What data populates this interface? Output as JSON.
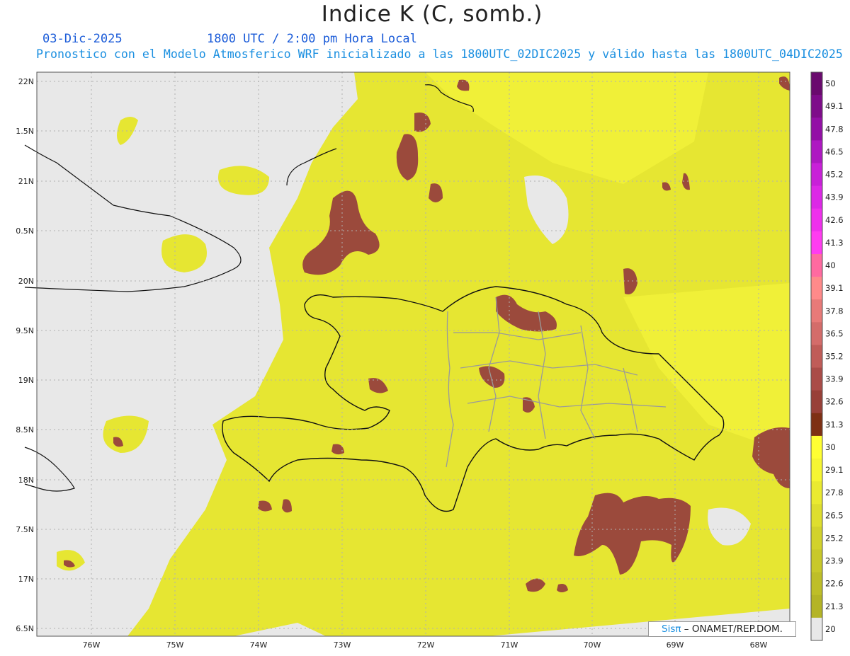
{
  "header": {
    "title": "Indice K (C, somb.)",
    "date": "03-Dic-2025",
    "time": "1800 UTC / 2:00 pm Hora Local",
    "subtitle": "Pronostico con el Modelo Atmosferico WRF inicializado a las 1800UTC_02DIC2025 y válido hasta las  1800UTC_04DIC2025"
  },
  "axes": {
    "lon_ticks": [
      "76W",
      "75W",
      "74W",
      "73W",
      "72W",
      "71W",
      "70W",
      "69W",
      "68W"
    ],
    "lat_ticks": [
      "22N",
      "1.5N",
      "21N",
      "0.5N",
      "20N",
      "9.5N",
      "19N",
      "8.5N",
      "18N",
      "7.5N",
      "17N",
      "6.5N"
    ]
  },
  "colorbar": {
    "labels": [
      "50",
      "49.1",
      "47.8",
      "46.5",
      "45.2",
      "43.9",
      "42.6",
      "41.3",
      "40",
      "39.1",
      "37.8",
      "36.5",
      "35.2",
      "33.9",
      "32.6",
      "31.3",
      "30",
      "29.1",
      "27.8",
      "26.5",
      "25.2",
      "23.9",
      "22.6",
      "21.3",
      "20"
    ],
    "colors": [
      "#6a0a6e",
      "#7e0c8a",
      "#9310a6",
      "#ae18c2",
      "#c820d8",
      "#dc28e6",
      "#ef30ec",
      "#ff3cf0",
      "#ff6aa0",
      "#ff8a8a",
      "#e87a78",
      "#d46c6a",
      "#c05c58",
      "#aa4c48",
      "#984038",
      "#7e3014",
      "#ffff33",
      "#f6f632",
      "#eaea30",
      "#dede2e",
      "#d2d22c",
      "#c8c82a",
      "#bebe28",
      "#b4b426",
      "#e8e8e8"
    ]
  },
  "map_colors": {
    "ocean": "#e8e8e8",
    "k_high": "#9b4a3c",
    "k_mid": "#d8d82e",
    "k_low": "#eded36"
  },
  "credit": {
    "sis": "Sisπ",
    "rest": " – ONAMET/REP.DOM."
  }
}
